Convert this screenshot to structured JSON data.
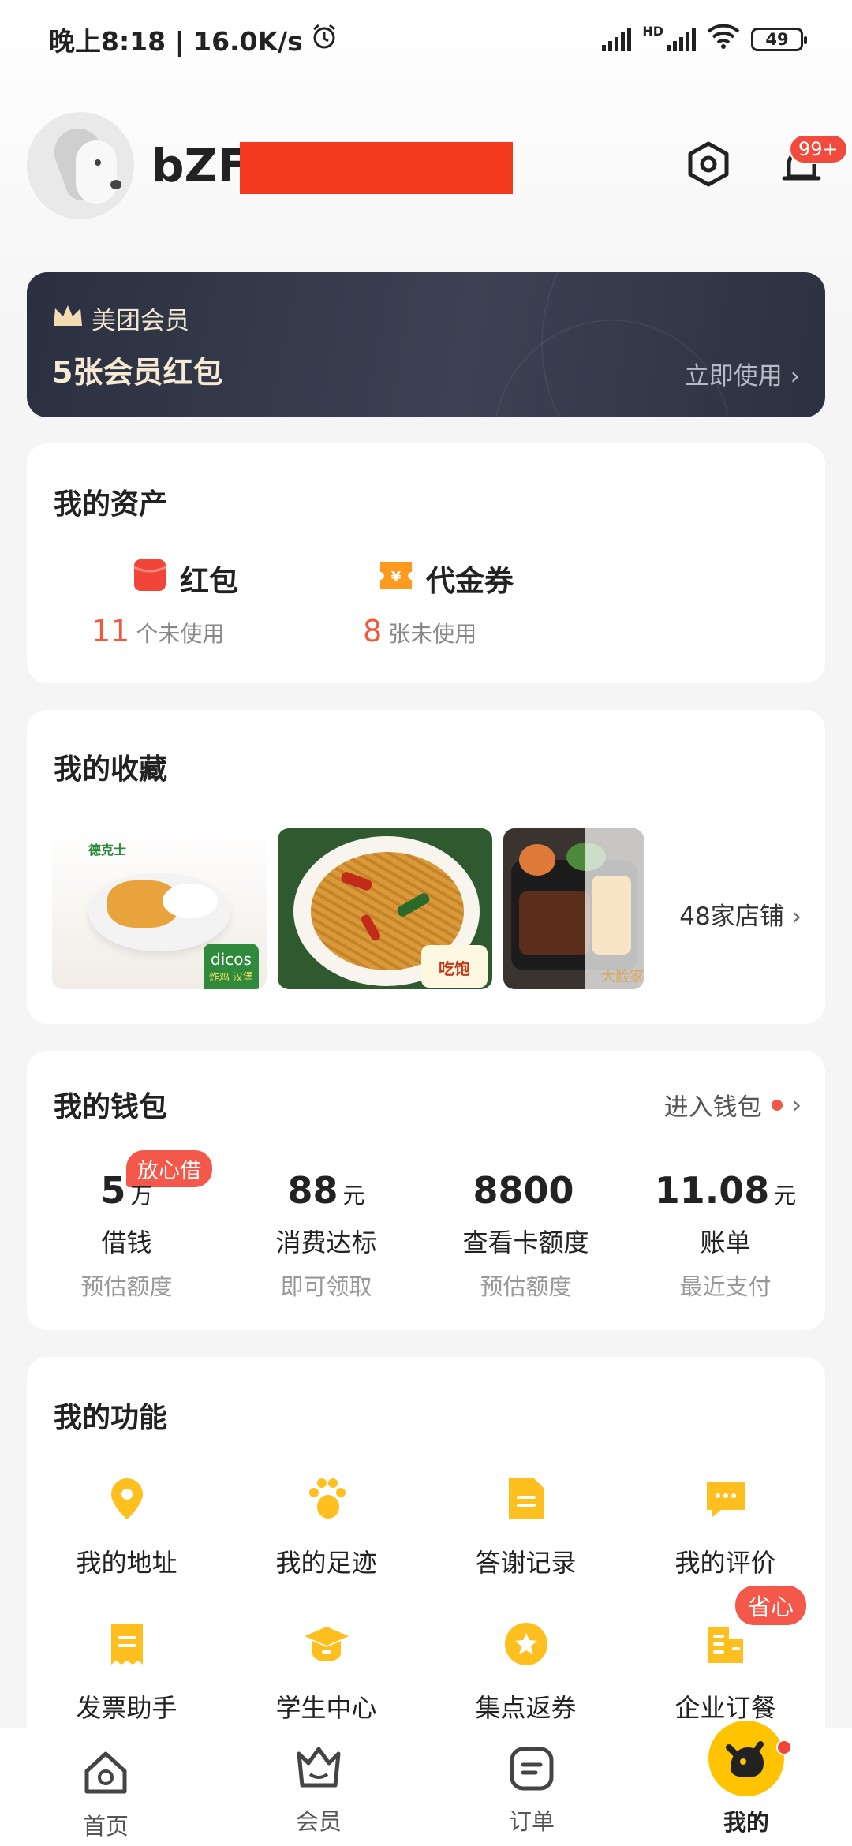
{
  "status_bar": {
    "time": "晚上8:18 | 16.0K/s",
    "hd_label": "HD",
    "battery": "49"
  },
  "profile": {
    "username": "bZF",
    "notification_badge": "99+"
  },
  "member_banner": {
    "label": "美团会员",
    "title": "5张会员红包",
    "cta": "立即使用"
  },
  "assets": {
    "title": "我的资产",
    "items": [
      {
        "name": "红包",
        "count": "11",
        "desc": "个未使用",
        "icon": "red-packet-icon",
        "color": "#f2453a"
      },
      {
        "name": "代金券",
        "count": "8",
        "desc": "张未使用",
        "icon": "voucher-icon",
        "color": "#ff9a1f"
      }
    ]
  },
  "favorites": {
    "title": "我的收藏",
    "store_count": "48家店铺",
    "thumbs": [
      {
        "name": "dicos-thumbnail",
        "caption_top": "德克士",
        "caption": "dicos",
        "caption_sub": "炸鸡 汉堡"
      },
      {
        "name": "noodle-thumbnail",
        "caption": "吃饱"
      },
      {
        "name": "beef-rice-thumbnail",
        "caption": "大脸家"
      }
    ]
  },
  "wallet": {
    "title": "我的钱包",
    "enter": "进入钱包",
    "tag": "放心借",
    "items": [
      {
        "value": "5",
        "unit": "万",
        "label": "借钱",
        "sub": "预估额度"
      },
      {
        "value": "88",
        "unit": "元",
        "label": "消费达标",
        "sub": "即可领取"
      },
      {
        "value": "8800",
        "unit": "",
        "label": "查看卡额度",
        "sub": "预估额度"
      },
      {
        "value": "11.08",
        "unit": "元",
        "label": "账单",
        "sub": "最近支付"
      }
    ]
  },
  "functions": {
    "title": "我的功能",
    "tag": "省心",
    "items": [
      {
        "label": "我的地址",
        "icon": "location-pin-icon"
      },
      {
        "label": "我的足迹",
        "icon": "paw-print-icon"
      },
      {
        "label": "答谢记录",
        "icon": "document-icon"
      },
      {
        "label": "我的评价",
        "icon": "comment-bubble-icon"
      },
      {
        "label": "发票助手",
        "icon": "receipt-icon"
      },
      {
        "label": "学生中心",
        "icon": "graduation-cap-icon"
      },
      {
        "label": "集点返券",
        "icon": "star-coin-icon"
      },
      {
        "label": "企业订餐",
        "icon": "building-icon"
      }
    ]
  },
  "bottom_nav": {
    "items": [
      {
        "label": "首页",
        "icon": "home-mascot-icon"
      },
      {
        "label": "会员",
        "icon": "member-crown-icon"
      },
      {
        "label": "订单",
        "icon": "order-icon"
      },
      {
        "label": "我的",
        "icon": "mine-mascot-icon"
      }
    ],
    "active_color": "#ffc300"
  },
  "colors": {
    "accent": "#ffc300",
    "highlight_red": "#f05a38",
    "banner_dark": "#2b3040"
  }
}
